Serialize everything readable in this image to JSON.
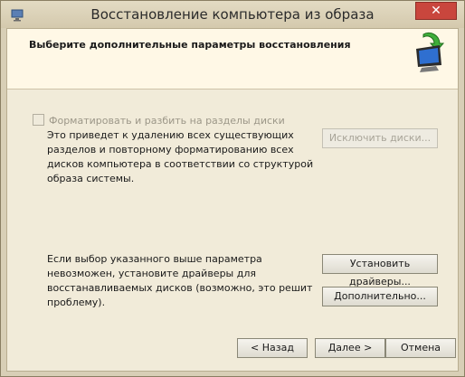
{
  "window": {
    "title": "Восстановление компьютера из образа",
    "close_label": "✕"
  },
  "header": {
    "title": "Выберите дополнительные параметры восстановления"
  },
  "options": {
    "format_checkbox_label": "Форматировать и разбить на разделы диски",
    "format_checked": false,
    "format_description": "Это приведет к удалению всех существующих разделов и повторному форматированию всех дисков компьютера в соответствии со структурой образа системы.",
    "exclude_disks_label": "Исключить диски...",
    "drivers_description": "Если выбор указанного выше параметра невозможен, установите драйверы для восстанавливаемых дисков (возможно, это решит проблему).",
    "install_drivers_label": "Установить драйверы...",
    "advanced_label": "Дополнительно..."
  },
  "footer": {
    "back_label": "< Назад",
    "next_label": "Далее >",
    "cancel_label": "Отмена"
  },
  "icons": {
    "app": "backup-restore-icon",
    "header": "monitor-restore-icon"
  }
}
